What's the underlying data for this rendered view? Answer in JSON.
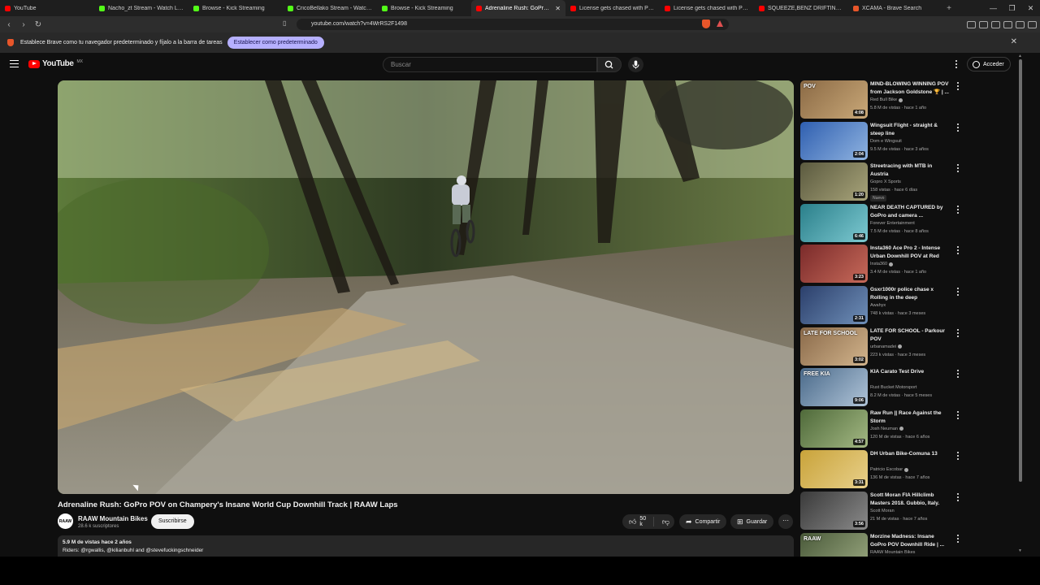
{
  "tabs": [
    {
      "label": "YouTube",
      "color": "#ff0000"
    },
    {
      "label": "Nacho_zt Stream - Watch Live on Kick",
      "color": "#53fc18"
    },
    {
      "label": "Browse - Kick Streaming",
      "color": "#53fc18"
    },
    {
      "label": "CricoBellako Stream - Watch Live on Kick",
      "color": "#53fc18"
    },
    {
      "label": "Browse - Kick Streaming",
      "color": "#53fc18"
    },
    {
      "label": "Adrenaline Rush: GoPro POV on Champery's",
      "color": "#ff0000",
      "active": true
    },
    {
      "label": "License gets chased with Punchman",
      "color": "#ff0000"
    },
    {
      "label": "License gets chased with Punchman",
      "color": "#ff0000"
    },
    {
      "label": "SQUEEZE,BENZ DRIFTING on TIME",
      "color": "#ff0000"
    },
    {
      "label": "XCAMA - Brave Search",
      "color": "#e8562a"
    }
  ],
  "address": {
    "url": "youtube.com/watch?v=4WrRS2F1498"
  },
  "infobar": {
    "text": "Establece Brave como tu navegador predeterminado y fíjalo a la barra de tareas",
    "button": "Establecer como predeterminado"
  },
  "header": {
    "logo": "YouTube",
    "region": "MX",
    "search_placeholder": "Buscar",
    "signin": "Acceder"
  },
  "video": {
    "title": "Adrenaline Rush: GoPro POV on Champery's Insane World Cup Downhill Track | RAAW Laps",
    "channel": "RAAW Mountain Bikes",
    "channel_short": "RAAW",
    "subscribers": "28.6 k suscriptores",
    "subscribe": "Suscribirse",
    "likes": "50 k",
    "share": "Compartir",
    "save": "Guardar",
    "views_age": "5.9 M de vistas  hace 2 años",
    "riders": "Riders: @rgwallis, @kilianbuhl and @stevefuckingschneider"
  },
  "related": [
    {
      "title": "MIND-BLOWING WINNING POV from Jackson Goldstone 🏆 | ...",
      "channel": "Red Bull Bike",
      "verified": true,
      "meta": "5.8 M de vistas · hace 1 año",
      "duration": "4:08",
      "thumb_text": "POV",
      "c1": "#8b6a45",
      "c2": "#c9a878"
    },
    {
      "title": "Wingsuit Flight - straight & steep line",
      "channel": "Dom e Wingsuit",
      "meta": "9.5 M de vistas · hace 3 años",
      "duration": "2:04",
      "c1": "#2f5fb0",
      "c2": "#8fb3e0"
    },
    {
      "title": "Streetracing with MTB in Austria",
      "channel": "Gopro X Sports",
      "meta": "158 vistas · hace 6 días",
      "duration": "1:20",
      "badge": "Nuevo",
      "c1": "#5b5a3f",
      "c2": "#a8a47a"
    },
    {
      "title": "NEAR DEATH CAPTURED by GoPro and camera ...",
      "channel": "Forever Entertainment",
      "meta": "7.5 M de vistas · hace 8 años",
      "duration": "6:46",
      "c1": "#2a7f8a",
      "c2": "#7dc9d1"
    },
    {
      "title": "Insta360 Ace Pro 2 - Intense Urban Downhill POV at Red Bu...",
      "channel": "Insta360",
      "verified": true,
      "meta": "3.4 M de vistas · hace 1 año",
      "duration": "3:23",
      "c1": "#7a2a2a",
      "c2": "#c76a5a"
    },
    {
      "title": "Gsxr1000r police chase x Rolling in the deep",
      "channel": "Awahyx",
      "meta": "748 k vistas · hace 3 meses",
      "duration": "2:31",
      "c1": "#2b3f6b",
      "c2": "#6f8fb8"
    },
    {
      "title": "LATE FOR SCHOOL - Parkour POV",
      "channel": "urbanamadei",
      "verified": true,
      "meta": "223 k vistas · hace 3 meses",
      "duration": "3:02",
      "thumb_text": "LATE FOR SCHOOL",
      "c1": "#8a6a4a",
      "c2": "#d2b48c"
    },
    {
      "title": "KIA Carato Test Drive",
      "channel": "Rust Bucket Motorsport",
      "meta": "8.2 M de vistas · hace 5 meses",
      "duration": "9:06",
      "thumb_text": "FREE KIA",
      "c1": "#4a6a8a",
      "c2": "#b0c4d8"
    },
    {
      "title": "Raw Run || Race Against the Storm",
      "channel": "Josh Neuman",
      "verified": true,
      "meta": "120 M de vistas · hace 6 años",
      "duration": "4:57",
      "c1": "#4f6a3a",
      "c2": "#a3b883"
    },
    {
      "title": "DH Urban Bike-Comuna 13",
      "channel": "Patricio Escobar",
      "verified": true,
      "meta": "136 M de vistas · hace 7 años",
      "duration": "3:31",
      "c1": "#c9a33a",
      "c2": "#e8d08a"
    },
    {
      "title": "Scott Moran FIA Hillclimb Masters 2018. Gubbio, Italy.",
      "channel": "Scott Moran",
      "meta": "21 M de vistas · hace 7 años",
      "duration": "3:56",
      "c1": "#3a3a3a",
      "c2": "#8a8a8a"
    },
    {
      "title": "Morzine Madness: Insane GoPro POV Downhill Ride | ...",
      "channel": "RAAW Mountain Bikes",
      "meta": "",
      "duration": "",
      "thumb_text": "RAAW",
      "c1": "#4a5a3a",
      "c2": "#9aa880"
    }
  ],
  "colors": {
    "accent": "#ff0000",
    "background": "#0f0f0f",
    "chip": "#272727",
    "brave": "#e8562a"
  }
}
